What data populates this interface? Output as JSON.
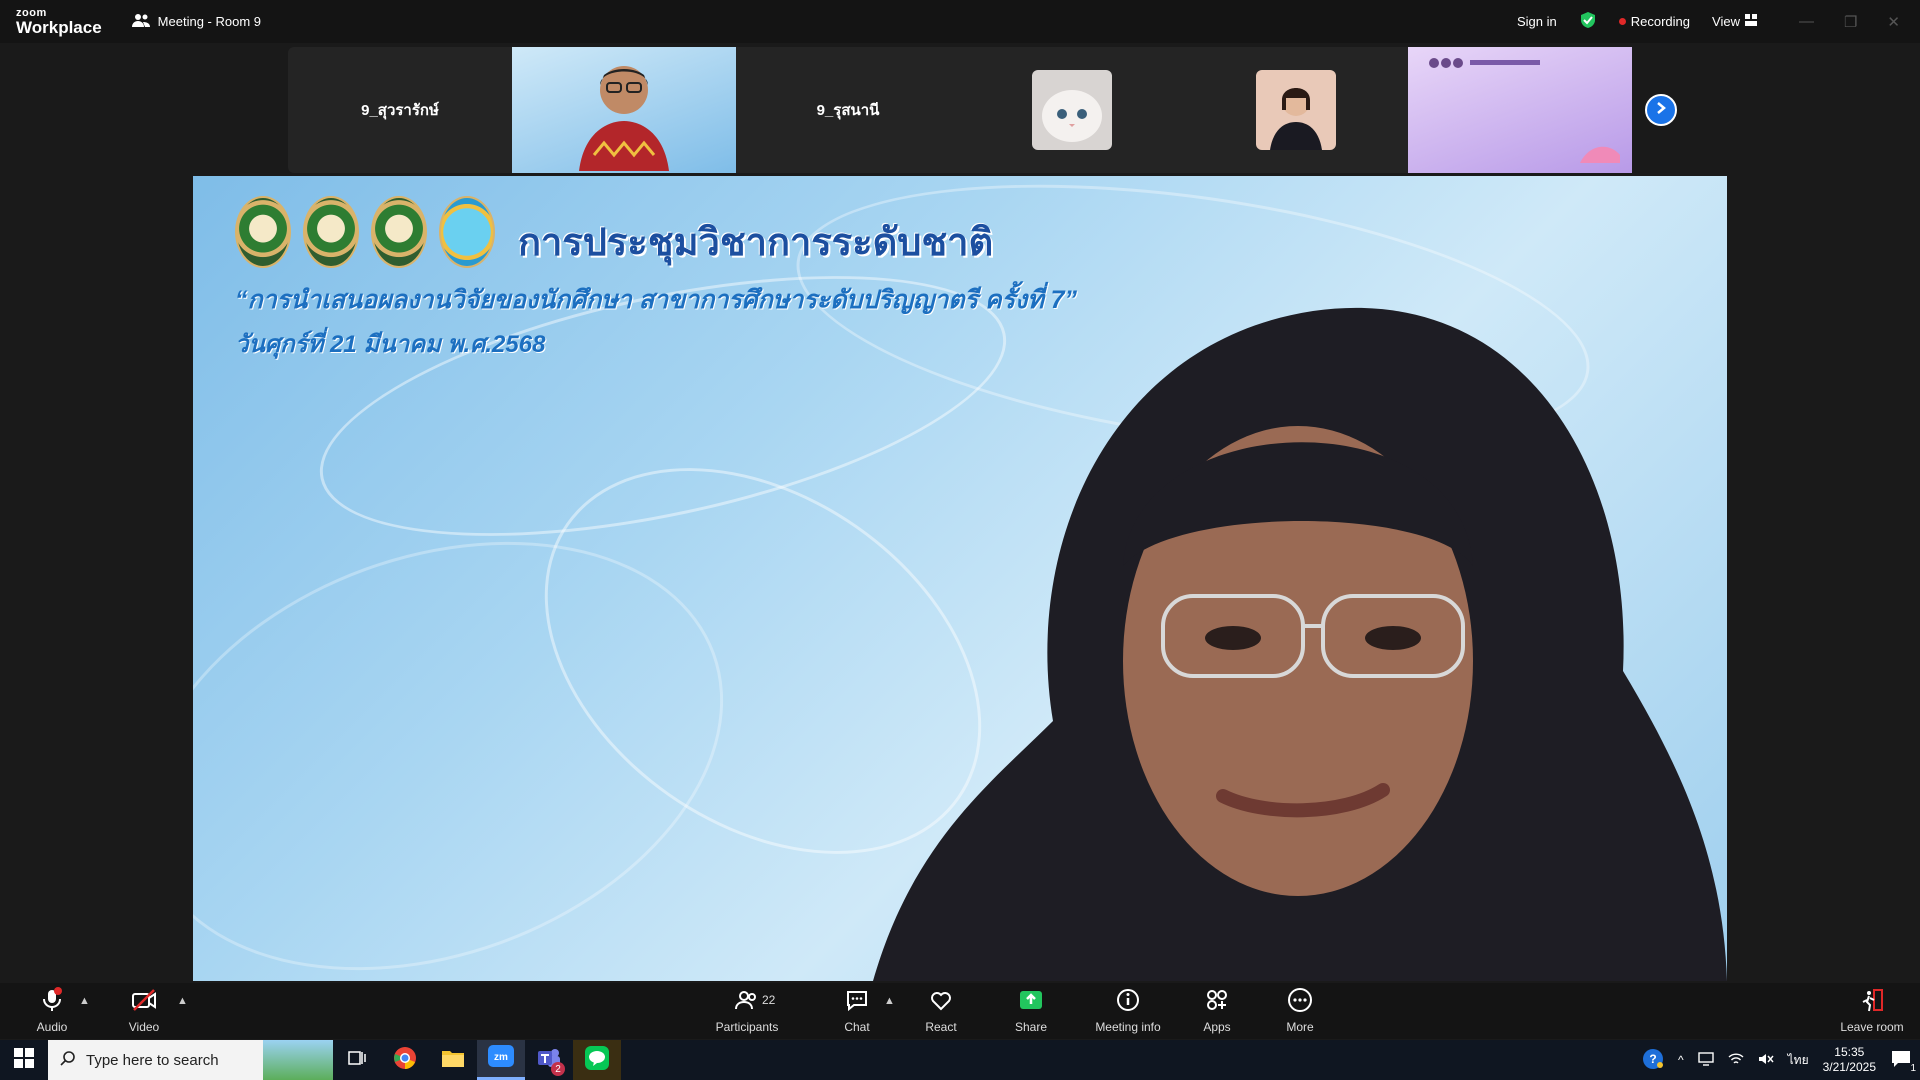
{
  "titlebar": {
    "brand_top": "zoom",
    "brand_bottom": "Workplace",
    "meeting_title": "Meeting - Room 9",
    "sign_in": "Sign in",
    "recording": "Recording",
    "view": "View"
  },
  "gallery": {
    "tiles": [
      {
        "type": "name",
        "label": "9_สุวรารักษ์"
      },
      {
        "type": "video",
        "icon": "person-video"
      },
      {
        "type": "name",
        "label": "9_รุสนานี"
      },
      {
        "type": "image",
        "icon": "cat-avatar"
      },
      {
        "type": "image",
        "icon": "person-avatar"
      },
      {
        "type": "video",
        "icon": "slide-video"
      }
    ]
  },
  "banner": {
    "title": "การประชุมวิชาการระดับชาติ",
    "subtitle": "“การนำเสนอผลงานวิจัยของนักศึกษา สาขาการศึกษาระดับปริญญาตรี ครั้งที่ 7”",
    "date": "วันศุกร์ที่  21 มีนาคม พ.ศ.2568"
  },
  "controls": {
    "audio": "Audio",
    "video": "Video",
    "participants": "Participants",
    "participants_count": "22",
    "chat": "Chat",
    "react": "React",
    "share": "Share",
    "meeting_info": "Meeting info",
    "apps": "Apps",
    "more": "More",
    "leave": "Leave room"
  },
  "taskbar": {
    "search_placeholder": "Type here to search",
    "time": "15:35",
    "date": "3/21/2025",
    "lang": "ไทย",
    "teams_badge": "2",
    "notif_count": "1"
  },
  "colors": {
    "share_green": "#22c55e",
    "accent_blue": "#1a73e8",
    "recording_red": "#e02828"
  }
}
